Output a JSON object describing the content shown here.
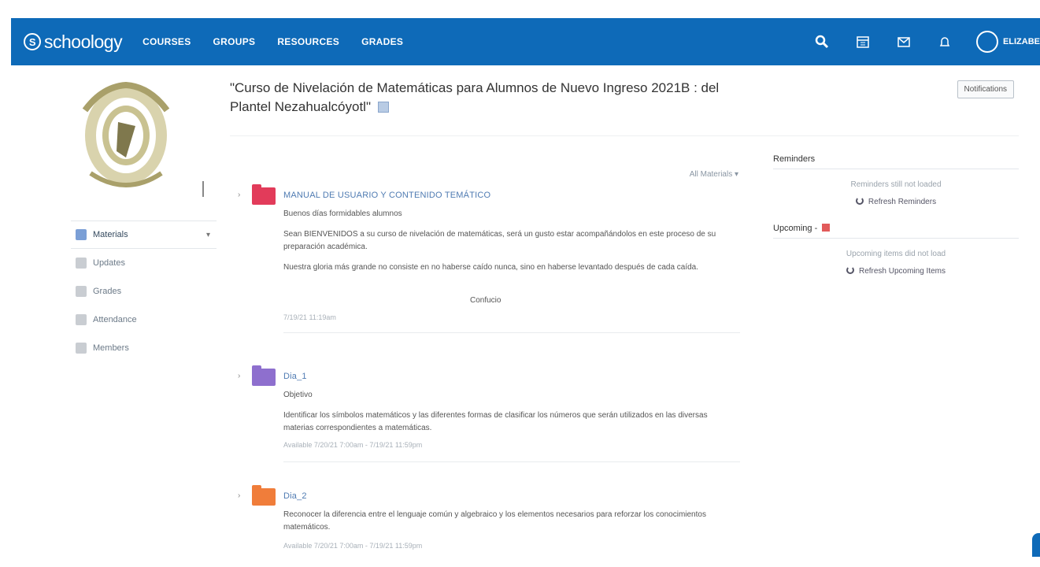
{
  "app": {
    "logo_text": "schoology",
    "nav": [
      "COURSES",
      "GROUPS",
      "RESOURCES",
      "GRADES"
    ],
    "user_name": "ELIZABE"
  },
  "sidebar": {
    "items": [
      {
        "label": "Materials",
        "icon": "materials-icon"
      },
      {
        "label": "Updates",
        "icon": "updates-icon"
      },
      {
        "label": "Grades",
        "icon": "grades-icon"
      },
      {
        "label": "Attendance",
        "icon": "attendance-icon"
      },
      {
        "label": "Members",
        "icon": "members-icon"
      }
    ]
  },
  "course": {
    "title": "\"Curso de Nivelación de Matemáticas para Alumnos de Nuevo Ingreso 2021B : del Plantel Nezahualcóyotl\"",
    "notifications_label": "Notifications"
  },
  "materials": {
    "filter_label": "All Materials ▾",
    "items": [
      {
        "title": "MANUAL DE USUARIO Y CONTENIDO TEMÁTICO",
        "color": "#e23b5a",
        "lines": [
          "Buenos días formidables alumnos",
          "Sean BIENVENIDOS a su curso de nivelación de matemáticas, será un gusto estar acompañándolos en este proceso de su preparación académica.",
          "Nuestra gloria más grande no consiste en no haberse caído nunca, sino en haberse levantado después de cada caída.",
          "Confucio"
        ],
        "meta": "7/19/21 11:19am"
      },
      {
        "title": "Dia_1",
        "color": "#8e6fce",
        "lines": [
          "Objetivo",
          "Identificar los símbolos matemáticos y las diferentes formas de clasificar los números que serán utilizados en las diversas materias correspondientes a matemáticas."
        ],
        "meta": "Available 7/20/21 7:00am - 7/19/21 11:59pm"
      },
      {
        "title": "Dia_2",
        "color": "#f07d3a",
        "lines": [
          "Reconocer la diferencia entre el lenguaje común y algebraico y los elementos necesarios para reforzar los conocimientos matemáticos."
        ],
        "meta": "Available 7/20/21 7:00am - 7/19/21 11:59pm"
      }
    ]
  },
  "right_panel": {
    "reminders_title": "Reminders",
    "reminders_empty": "Reminders still not loaded",
    "refresh_reminders": "Refresh Reminders",
    "upcoming_title": "Upcoming -",
    "upcoming_empty": "Upcoming items did not load",
    "refresh_upcoming": "Refresh Upcoming Items"
  },
  "colors": {
    "brand_blue": "#0e6ab8",
    "link": "#4f7bb2"
  }
}
